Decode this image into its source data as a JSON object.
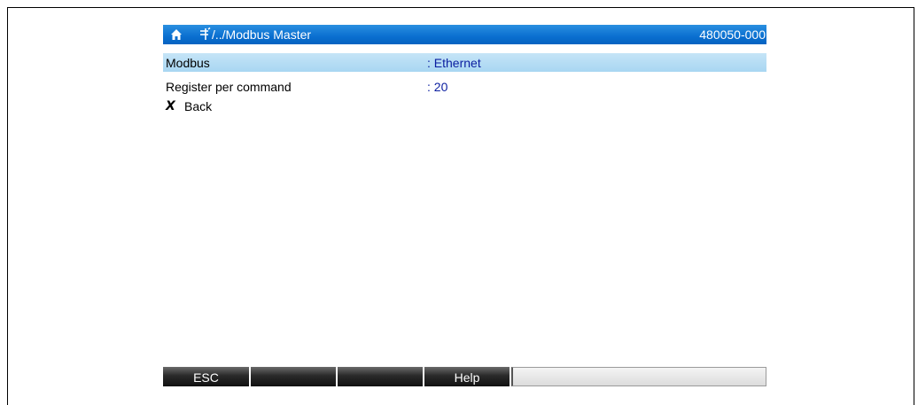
{
  "header": {
    "path": "/../Modbus Master",
    "device_id": "480050-000",
    "home_icon": "home-icon",
    "path_icon": "settings-tree-icon"
  },
  "menu": {
    "items": [
      {
        "label": "Modbus",
        "value": ": Ethernet",
        "selected": true
      },
      {
        "label": "Register per command",
        "value": ": 20",
        "selected": false
      }
    ],
    "back": {
      "icon": "X",
      "label": "Back"
    }
  },
  "softkeys": [
    "ESC",
    "",
    "",
    "Help"
  ],
  "colors": {
    "header_bg": "#0a6fd0",
    "selected_row_bg": "#b3dbf4",
    "value_text": "#0a1ea0",
    "softkey_bg": "#1a1a1a"
  }
}
